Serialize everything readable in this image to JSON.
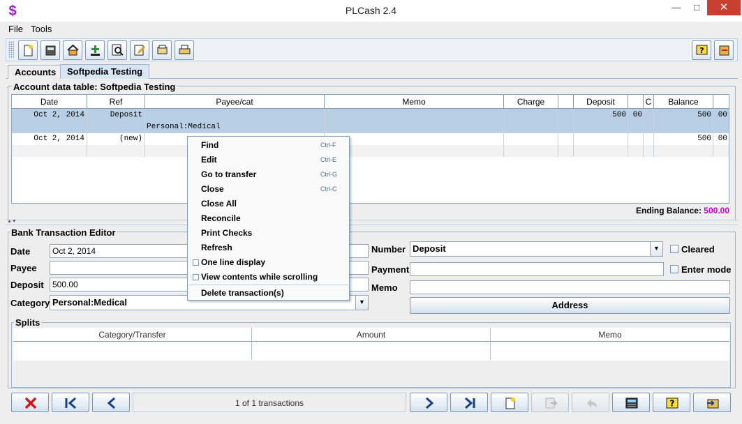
{
  "window": {
    "title": "PLCash 2.4",
    "app_icon_glyph": "$",
    "min_glyph": "—",
    "max_glyph": "□",
    "close_glyph": "✕"
  },
  "menubar": {
    "items": [
      "File",
      "Tools"
    ]
  },
  "toolbar": {
    "left_icons": [
      "new-document-icon",
      "printer-stack-icon",
      "home-icon",
      "add-icon",
      "find-icon",
      "edit-icon",
      "open-folder-icon",
      "print-icon"
    ],
    "right_icons": [
      "help-icon",
      "exit-icon"
    ]
  },
  "tabs": [
    {
      "label": "Accounts",
      "selected": false
    },
    {
      "label": "Softpedia Testing",
      "selected": true
    }
  ],
  "account_table": {
    "legend": "Account data table: Softpedia Testing",
    "columns": [
      "Date",
      "Ref",
      "Payee/cat",
      "Memo",
      "Charge",
      "",
      "Deposit",
      "",
      "C",
      "Balance",
      ""
    ],
    "rows": [
      {
        "date": "Oct 2, 2014",
        "ref": "Deposit",
        "payee": "",
        "category": "Personal:Medical",
        "memo": "",
        "charge": "",
        "deposit": "500",
        "deposit_cents": "00",
        "cleared": "",
        "balance": "500",
        "balance_cents": "00",
        "selected": true
      },
      {
        "date": "Oct 2, 2014",
        "ref": "(new)",
        "payee": "",
        "category": "",
        "memo": "",
        "charge": "",
        "deposit": "",
        "deposit_cents": "",
        "cleared": "",
        "balance": "500",
        "balance_cents": "00",
        "selected": false
      }
    ],
    "ending_balance_label": "Ending Balance:",
    "ending_balance_value": "500.00",
    "ending_balance_color": "#cc00cc"
  },
  "editor": {
    "legend": "Bank Transaction Editor",
    "date_label": "Date",
    "date_value": "Oct 2, 2014",
    "payee_label": "Payee",
    "payee_value": "",
    "deposit_label": "Deposit",
    "deposit_value": "500.00",
    "category_label": "Category",
    "category_value": "Personal:Medical",
    "number_label": "Number",
    "number_value": "Deposit",
    "payment_label": "Payment",
    "payment_value": "",
    "memo_label": "Memo",
    "memo_value": "",
    "cleared_label": "Cleared",
    "enter_mode_label": "Enter mode",
    "address_button": "Address"
  },
  "splits": {
    "legend": "Splits",
    "columns": [
      "Category/Transfer",
      "Amount",
      "Memo"
    ]
  },
  "bottom_bar": {
    "status": "1 of 1 transactions",
    "left_buttons": [
      "delete-icon",
      "first-record-icon",
      "previous-record-icon"
    ],
    "right_buttons": [
      "next-record-icon",
      "last-record-icon",
      "new-document-icon",
      "save-icon",
      "undo-icon",
      "calculator-icon",
      "help-icon",
      "close-folder-icon"
    ],
    "disabled": [
      "save-icon",
      "undo-icon"
    ]
  },
  "context_menu": {
    "items": [
      {
        "label": "Find",
        "accel": "Ctrl-F",
        "checkbox": false
      },
      {
        "label": "Edit",
        "accel": "Ctrl-E",
        "checkbox": false
      },
      {
        "label": "Go to transfer",
        "accel": "Ctrl-G",
        "checkbox": false
      },
      {
        "label": "Close",
        "accel": "Ctrl-C",
        "checkbox": false
      },
      {
        "label": "Close All",
        "accel": "",
        "checkbox": false
      },
      {
        "label": "Reconcile",
        "accel": "",
        "checkbox": false
      },
      {
        "label": "Print Checks",
        "accel": "",
        "checkbox": false
      },
      {
        "label": "Refresh",
        "accel": "",
        "checkbox": false
      },
      {
        "label": "One line display",
        "accel": "",
        "checkbox": true,
        "checked": false
      },
      {
        "label": "View contents while scrolling",
        "accel": "",
        "checkbox": true,
        "checked": false
      },
      {
        "label": "Delete transaction(s)",
        "accel": "",
        "checkbox": false
      }
    ]
  }
}
